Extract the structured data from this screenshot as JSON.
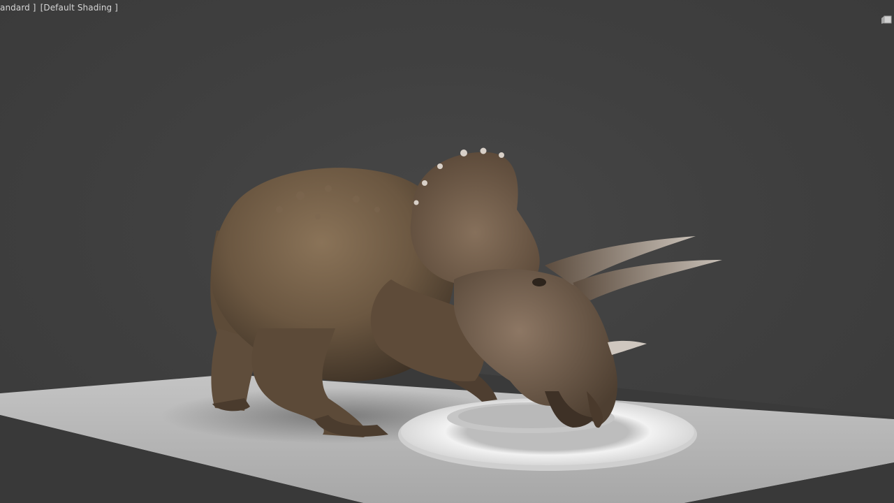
{
  "viewport": {
    "view_mode_label": "andard ]",
    "shading_label": "[Default Shading ]"
  },
  "scene": {
    "model": "triceratops",
    "prop": "water-ring",
    "ground": "ground-plane"
  },
  "colors": {
    "background": "#404040",
    "ground": "#b5b5b5",
    "skin": "#6e5a44",
    "ring": "#e6e6e6"
  },
  "icons": {
    "viewport_corner": "viewcube-icon"
  }
}
